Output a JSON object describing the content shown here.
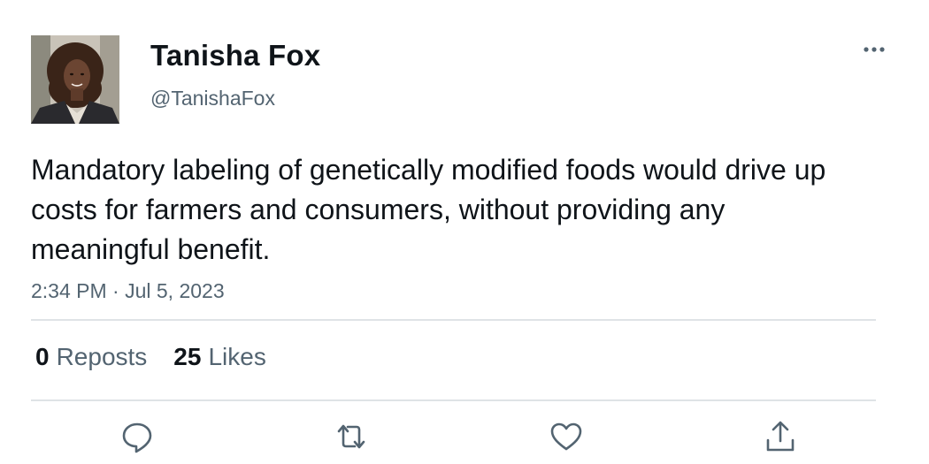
{
  "author": {
    "display_name": "Tanisha Fox",
    "handle": "@TanishaFox",
    "avatar_icon": "profile-photo"
  },
  "tweet": {
    "text": "Mandatory labeling of genetically modified foods would drive up costs for farmers and consumers, without providing any meaningful benefit.",
    "timestamp": "2:34 PM · Jul 5, 2023"
  },
  "stats": {
    "reposts_count": "0",
    "reposts_label": "Reposts",
    "likes_count": "25",
    "likes_label": "Likes"
  },
  "actions": {
    "icons": [
      "reply-icon",
      "repost-icon",
      "like-icon",
      "share-icon"
    ]
  },
  "colors": {
    "text_primary": "#0f1419",
    "text_secondary": "#536471",
    "divider": "#dfe3e6",
    "icon": "#536471"
  }
}
